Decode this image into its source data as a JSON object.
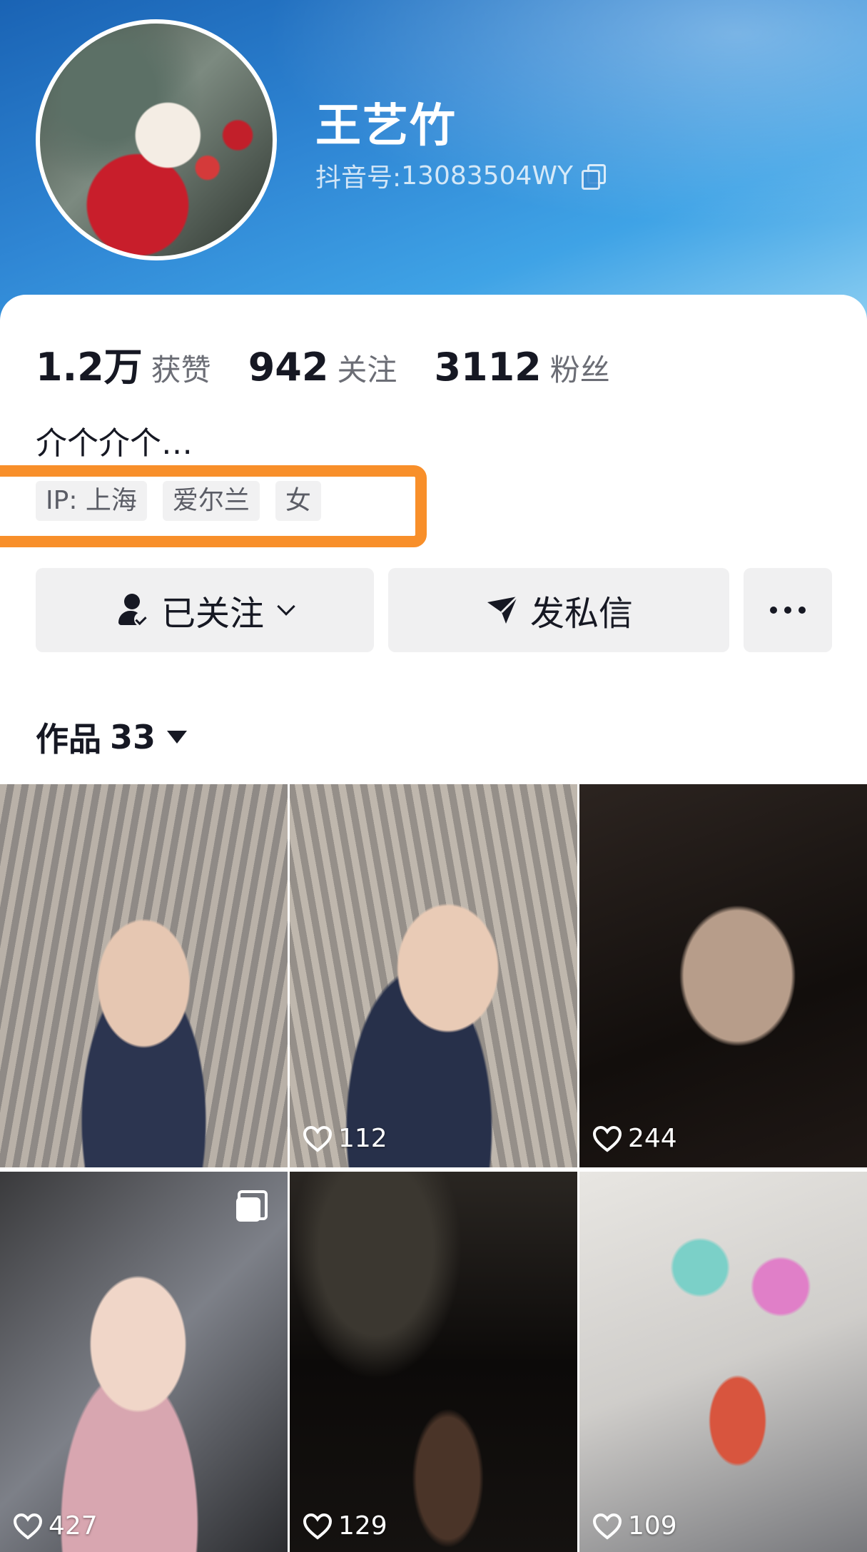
{
  "profile": {
    "name": "王艺竹",
    "uid_label": "抖音号:",
    "uid_value": "13083504WY",
    "bio": "介个介个…"
  },
  "stats": [
    {
      "value": "1.2万",
      "label": "获赞"
    },
    {
      "value": "942",
      "label": "关注"
    },
    {
      "value": "3112",
      "label": "粉丝"
    }
  ],
  "tags": [
    "IP:  上海",
    "爱尔兰",
    "女"
  ],
  "actions": {
    "follow_label": "已关注",
    "message_label": "发私信"
  },
  "works": {
    "label": "作品",
    "count": "33"
  },
  "videos": [
    {
      "likes": ""
    },
    {
      "likes": "112"
    },
    {
      "likes": "244"
    },
    {
      "likes": "427"
    },
    {
      "likes": "129"
    },
    {
      "likes": "109"
    }
  ],
  "colors": {
    "highlight_box": "#f88f2a",
    "header_blue": "#2f86d4",
    "button_bg": "#f0f0f1"
  }
}
